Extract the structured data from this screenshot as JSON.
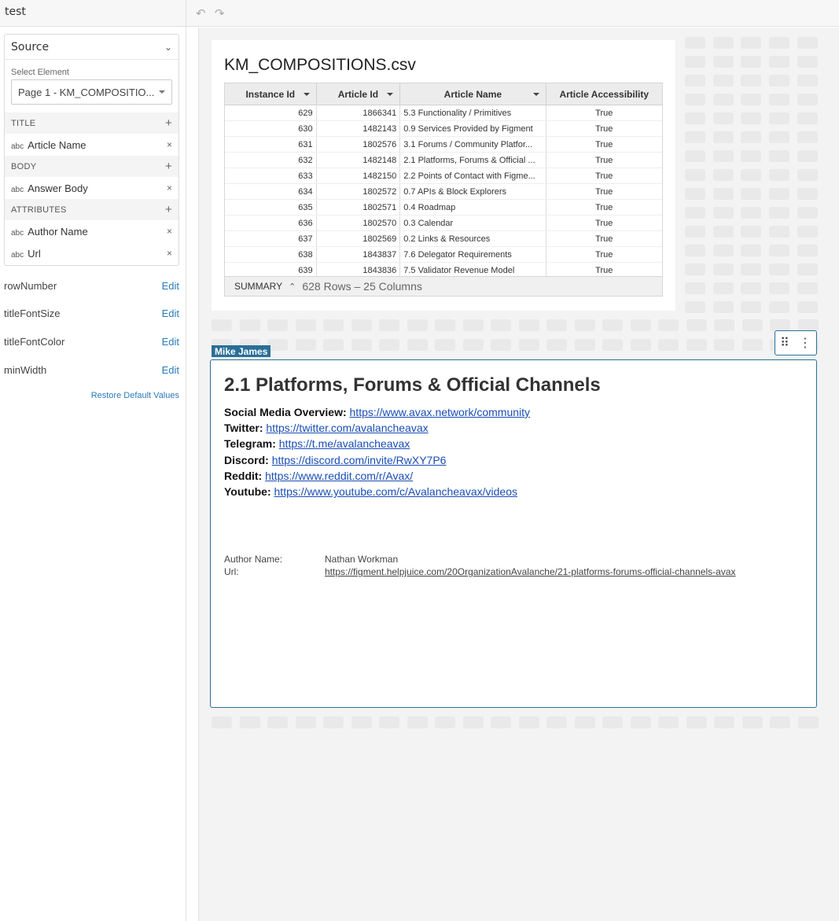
{
  "app": {
    "name": "test"
  },
  "sidebar": {
    "source_label": "Source",
    "select_label": "Select Element",
    "select_value": "Page 1 - KM_COMPOSITIO...",
    "sections": [
      {
        "label": "TITLE",
        "fields": [
          {
            "type": "abc",
            "name": "Article Name"
          }
        ]
      },
      {
        "label": "BODY",
        "fields": [
          {
            "type": "abc",
            "name": "Answer Body"
          }
        ]
      },
      {
        "label": "ATTRIBUTES",
        "fields": [
          {
            "type": "abc",
            "name": "Author Name"
          },
          {
            "type": "abc",
            "name": "Url"
          }
        ]
      }
    ],
    "props": [
      {
        "name": "rowNumber",
        "action": "Edit"
      },
      {
        "name": "titleFontSize",
        "action": "Edit"
      },
      {
        "name": "titleFontColor",
        "action": "Edit"
      },
      {
        "name": "minWidth",
        "action": "Edit"
      }
    ],
    "restore_label": "Restore Default Values"
  },
  "toolbar": {
    "undo_icon": "undo-icon",
    "redo_icon": "redo-icon"
  },
  "table": {
    "title": "KM_COMPOSITIONS.csv",
    "columns": [
      "Instance Id",
      "Article Id",
      "Article Name",
      "Article Accessibility"
    ],
    "rows": [
      [
        "629",
        "1866341",
        "5.3 Functionality / Primitives",
        "True"
      ],
      [
        "630",
        "1482143",
        "0.9 Services Provided by Figment",
        "True"
      ],
      [
        "631",
        "1802576",
        "3.1 Forums / Community Platfor...",
        "True"
      ],
      [
        "632",
        "1482148",
        "2.1 Platforms, Forums & Official ...",
        "True"
      ],
      [
        "633",
        "1482150",
        "2.2 Points of Contact with Figme...",
        "True"
      ],
      [
        "634",
        "1802572",
        "0.7 APIs & Block Explorers",
        "True"
      ],
      [
        "635",
        "1802571",
        "0.4 Roadmap",
        "True"
      ],
      [
        "636",
        "1802570",
        "0.3 Calendar",
        "True"
      ],
      [
        "637",
        "1802569",
        "0.2 Links & Resources",
        "True"
      ],
      [
        "638",
        "1843837",
        "7.6 Delegator Requirements",
        "True"
      ],
      [
        "639",
        "1843836",
        "7.5 Validator Revenue Model",
        "True"
      ]
    ],
    "summary_label": "SUMMARY",
    "summary_info": "628 Rows – 25 Columns"
  },
  "card": {
    "tag": "Mike James",
    "title": "2.1 Platforms, Forums & Official Channels",
    "links": [
      {
        "label": "Social Media Overview:",
        "url": "https://www.avax.network/community"
      },
      {
        "label": "Twitter:",
        "url": "https://twitter.com/avalancheavax"
      },
      {
        "label": "Telegram:",
        "url": "https://t.me/avalancheavax"
      },
      {
        "label": "Discord:",
        "url": "https://discord.com/invite/RwXY7P6"
      },
      {
        "label": "Reddit:",
        "url": "https://www.reddit.com/r/Avax/"
      },
      {
        "label": "Youtube:",
        "url": "https://www.youtube.com/c/Avalancheavax/videos"
      }
    ],
    "meta": [
      {
        "key": "Author Name:",
        "value": "Nathan Workman"
      },
      {
        "key": "Url:",
        "value": "https://figment.helpjuice.com/20OrganizationAvalanche/21-platforms-forums-official-channels-avax"
      }
    ]
  }
}
